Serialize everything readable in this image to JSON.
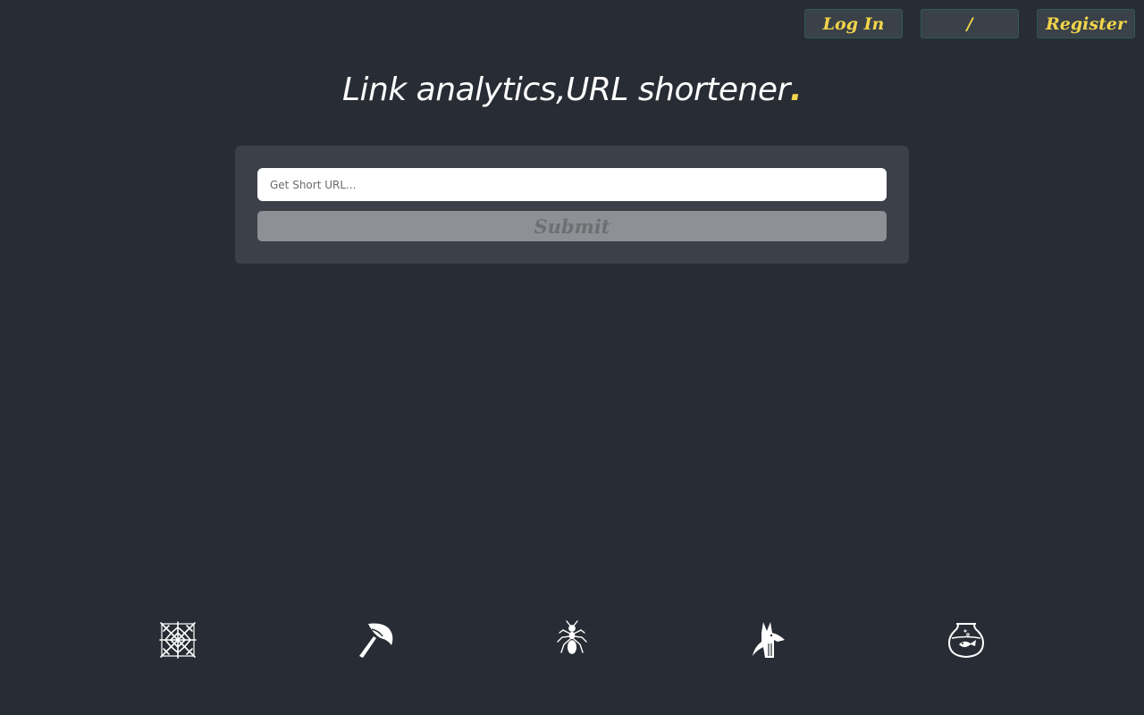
{
  "nav": {
    "login_label": "Log In",
    "slash_label": "/",
    "register_label": "Register"
  },
  "headline": {
    "text": "Link analytics,URL shortener",
    "dot": "."
  },
  "form": {
    "input_placeholder": "Get Short URL...",
    "input_value": "",
    "submit_label": "Submit"
  },
  "icons": [
    "spider-web-icon",
    "axe-icon",
    "ant-icon",
    "anubis-icon",
    "fishbowl-icon"
  ],
  "colors": {
    "background": "#282c34",
    "accent": "#f2d54a",
    "card": "#3c4048"
  }
}
